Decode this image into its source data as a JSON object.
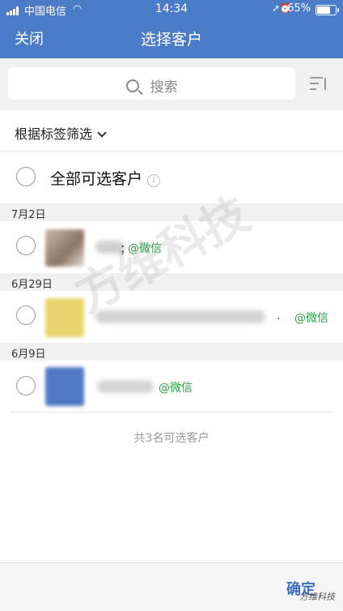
{
  "status_bar": {
    "carrier": "中国电信",
    "time": "14:34",
    "battery": "65%"
  },
  "nav": {
    "close_label": "关闭",
    "title": "选择客户"
  },
  "search": {
    "placeholder": "搜索"
  },
  "filter": {
    "label": "根据标签筛选"
  },
  "select_all": {
    "label": "全部可选客户",
    "info_glyph": "i"
  },
  "groups": [
    {
      "date": "7月2日",
      "customers": [
        {
          "name_suffix": "；",
          "source": "@微信"
        }
      ]
    },
    {
      "date": "6月29日",
      "customers": [
        {
          "name_suffix": ".",
          "source": "@微信"
        }
      ]
    },
    {
      "date": "6月9日",
      "customers": [
        {
          "source": "@微信"
        }
      ]
    }
  ],
  "summary": "共3名可选客户",
  "footer": {
    "confirm_label": "确定",
    "watermark": "方维科技"
  },
  "watermark_main": "方维科技",
  "colors": {
    "header": "#4a7cc7",
    "wechat": "#27a047",
    "confirm": "#3a6fc2"
  }
}
